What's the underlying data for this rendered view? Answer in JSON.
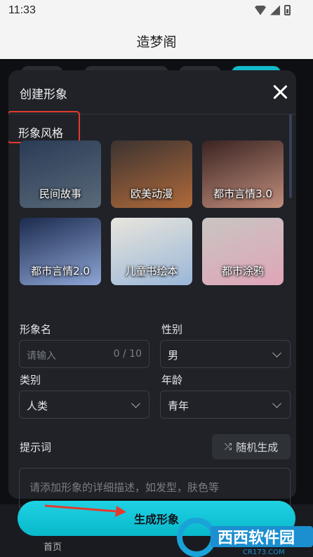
{
  "status_bar": {
    "time": "11:33"
  },
  "app": {
    "title": "造梦阁"
  },
  "dialog": {
    "title": "创建形象",
    "style_section_label": "形象风格",
    "styles": [
      {
        "name": "民间故事",
        "colors": [
          "#2a3b55",
          "#5a6a7a"
        ]
      },
      {
        "name": "欧美动漫",
        "colors": [
          "#3c3330",
          "#b06a3b"
        ]
      },
      {
        "name": "都市言情3.0",
        "colors": [
          "#3a2422",
          "#c28e7c"
        ]
      },
      {
        "name": "都市言情2.0",
        "colors": [
          "#1c2b4e",
          "#8ea6d6"
        ]
      },
      {
        "name": "儿童书绘本",
        "colors": [
          "#e8e5dc",
          "#9ab7d8"
        ]
      },
      {
        "name": "都市涂鸦",
        "colors": [
          "#c8c5c2",
          "#e0a5b8"
        ]
      },
      {
        "name": "",
        "colors": [
          "#2c2a28",
          "#6e6a64"
        ]
      },
      {
        "name": "",
        "colors": [
          "#22344a",
          "#5f7a96"
        ]
      },
      {
        "name": "",
        "colors": [
          "#0f0f10",
          "#3a3a3c"
        ]
      }
    ],
    "name_label": "形象名",
    "name_input": {
      "placeholder": "请输入",
      "counter": "0 / 10"
    },
    "gender_label": "性别",
    "gender_value": "男",
    "category_label": "类别",
    "category_value": "人类",
    "age_label": "年龄",
    "age_value": "青年",
    "prompt_label": "提示词",
    "random_button": "随机生成",
    "prompt_placeholder": "请添加形象的详细描述，如发型，肤色等"
  },
  "primary_button": "生成形象",
  "background": {
    "nav_label": "首页"
  },
  "watermark": {
    "brand": "西西软件园",
    "domain": "CR173.COM"
  },
  "colors": {
    "accent": "#14b9c8",
    "highlight": "#e23b2e",
    "dialog_bg": "#202228"
  }
}
